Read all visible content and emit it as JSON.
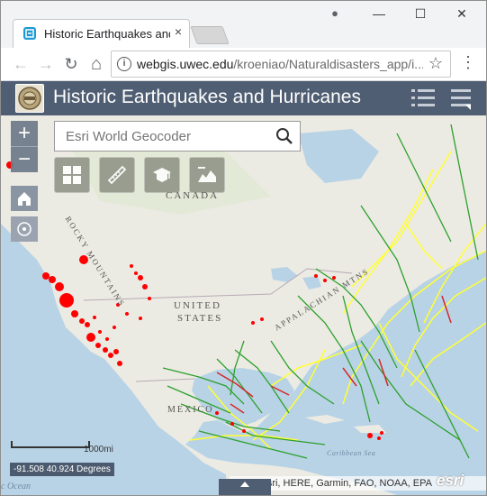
{
  "browser": {
    "tab_title": "Historic Earthquakes and",
    "tab_close": "×",
    "controls": {
      "profile": "●",
      "minimize": "—",
      "maximize": "☐",
      "close": "✕"
    },
    "nav": {
      "back": "←",
      "forward": "→",
      "reload": "↻",
      "home": "⌂"
    },
    "url_host": "webgis.uwec.edu",
    "url_path": "/kroeniao/Naturaldisasters_app/i...",
    "info": "i",
    "star": "☆",
    "menu": "⋮"
  },
  "app": {
    "title": "Historic Earthquakes and Hurricanes",
    "colors": {
      "header": "#4f5e73",
      "earthquake": "#ff0000",
      "hurricane_weak": "#ffff33",
      "hurricane_mid": "#2ca02c",
      "hurricane_strong": "#d62728"
    }
  },
  "map": {
    "zoom_in": "+",
    "zoom_out": "−",
    "search_placeholder": "Esri World Geocoder",
    "tools": [
      "basemap-gallery-icon",
      "measure-ruler-icon",
      "education-cap-icon",
      "elevation-profile-icon"
    ],
    "labels": {
      "canada": "CANADA",
      "rocky": "ROCKY MOUNTAINS",
      "us1": "UNITED",
      "us2": "STATES",
      "appalachian": "APPALACHIAN MTNS",
      "mexico": "MEXICO",
      "caribbean": "Caribbean Sea",
      "ocean": "c Ocean"
    },
    "scale_label": "1000mi",
    "coordinates": "-91.508 40.924 Degrees",
    "attribution": "Esri, HERE, Garmin, FAO, NOAA, EPA",
    "esri_logo": "esri"
  }
}
